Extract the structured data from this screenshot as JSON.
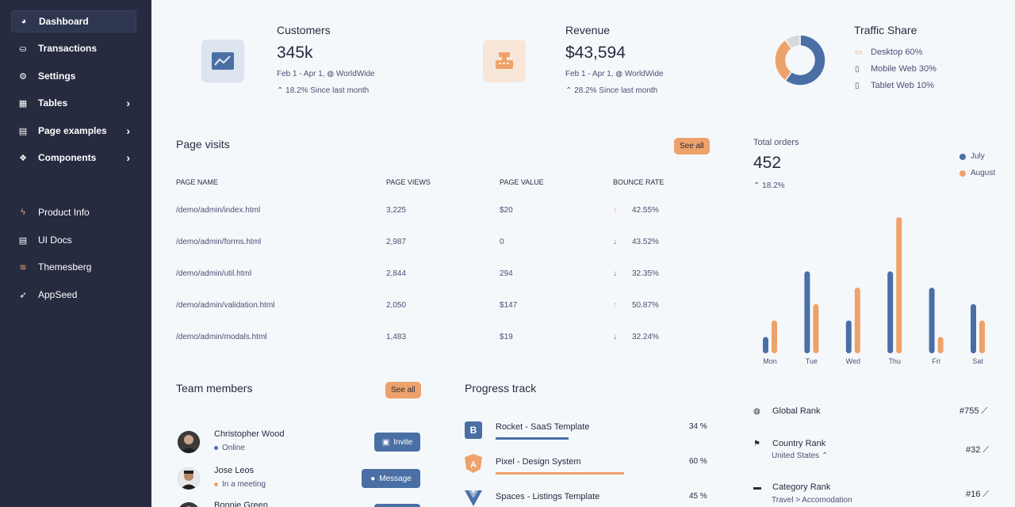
{
  "sidebar": {
    "items": [
      {
        "label": "Dashboard",
        "icon": "pie-chart-icon"
      },
      {
        "label": "Transactions",
        "icon": "hand-coin-icon"
      },
      {
        "label": "Settings",
        "icon": "gear-icon"
      },
      {
        "label": "Tables",
        "icon": "table-icon"
      },
      {
        "label": "Page examples",
        "icon": "file-icon"
      },
      {
        "label": "Components",
        "icon": "components-icon"
      },
      {
        "label": "Product Info",
        "icon": "bolt-icon"
      },
      {
        "label": "UI Docs",
        "icon": "document-icon"
      },
      {
        "label": "Themesberg",
        "icon": "themesberg-icon"
      },
      {
        "label": "AppSeed",
        "icon": "rocket-icon"
      }
    ]
  },
  "stats": {
    "customers": {
      "title": "Customers",
      "value": "345k",
      "range": "Feb 1 - Apr 1,",
      "region": "WorldWide",
      "delta": "18.2% Since last month"
    },
    "revenue": {
      "title": "Revenue",
      "value": "$43,594",
      "range": "Feb 1 - Apr 1,",
      "region": "WorldWide",
      "delta": "28.2% Since last month"
    }
  },
  "traffic": {
    "title": "Traffic Share",
    "items": [
      {
        "label": "Desktop 60%",
        "icon": "desktop-icon"
      },
      {
        "label": "Mobile Web 30%",
        "icon": "mobile-icon"
      },
      {
        "label": "Tablet Web 10%",
        "icon": "tablet-icon"
      }
    ],
    "shares": [
      60,
      30,
      10
    ]
  },
  "page_visits": {
    "title": "Page visits",
    "see_all": "See all",
    "headers": [
      "PAGE NAME",
      "PAGE VIEWS",
      "PAGE VALUE",
      "BOUNCE RATE"
    ],
    "rows": [
      {
        "name": "/demo/admin/index.html",
        "views": "3,225",
        "value": "$20",
        "bounce": "42.55%",
        "trend": "up"
      },
      {
        "name": "/demo/admin/forms.html",
        "views": "2,987",
        "value": "0",
        "bounce": "43.52%",
        "trend": "down"
      },
      {
        "name": "/demo/admin/util.html",
        "views": "2,844",
        "value": "294",
        "bounce": "32.35%",
        "trend": "down"
      },
      {
        "name": "/demo/admin/validation.html",
        "views": "2,050",
        "value": "$147",
        "bounce": "50.87%",
        "trend": "up"
      },
      {
        "name": "/demo/admin/modals.html",
        "views": "1,483",
        "value": "$19",
        "bounce": "32.24%",
        "trend": "down"
      }
    ]
  },
  "orders": {
    "label": "Total orders",
    "value": "452",
    "delta": "18.2%",
    "legend": [
      "July",
      "August"
    ]
  },
  "chart_data": {
    "type": "bar",
    "categories": [
      "Mon",
      "Tue",
      "Wed",
      "Thu",
      "Fri",
      "Sat"
    ],
    "series": [
      {
        "name": "July",
        "values": [
          1,
          5,
          2,
          5,
          4,
          3
        ],
        "color": "#4a6fa5"
      },
      {
        "name": "August",
        "values": [
          2,
          3,
          4,
          8.3,
          1,
          2
        ],
        "color": "#eea26b"
      }
    ],
    "ylim": [
      0,
      8.5
    ]
  },
  "team": {
    "title": "Team members",
    "see_all": "See all",
    "members": [
      {
        "name": "Christopher Wood",
        "status": "Online",
        "status_color": "#4a6fa5",
        "action": "Invite"
      },
      {
        "name": "Jose Leos",
        "status": "In a meeting",
        "status_color": "#eea26b",
        "action": "Message"
      },
      {
        "name": "Bonnie Green",
        "status": "",
        "status_color": "#4a6fa5",
        "action": ""
      }
    ]
  },
  "progress": {
    "title": "Progress track",
    "items": [
      {
        "name": "Rocket - SaaS Template",
        "pct_label": "34 %",
        "pct": 34,
        "color": "#4a6fa5",
        "icon": "bootstrap-icon"
      },
      {
        "name": "Pixel - Design System",
        "pct_label": "60 %",
        "pct": 60,
        "color": "#eea26b",
        "icon": "angular-icon"
      },
      {
        "name": "Spaces - Listings Template",
        "pct_label": "45 %",
        "pct": 45,
        "color": "#4a6fa5",
        "icon": "vue-icon"
      }
    ]
  },
  "ranks": [
    {
      "label": "Global Rank",
      "sub": "",
      "value": "#755",
      "icon": "globe-icon"
    },
    {
      "label": "Country Rank",
      "sub": "United States",
      "value": "#32",
      "icon": "flag-icon"
    },
    {
      "label": "Category Rank",
      "sub": "Travel > Accomodation",
      "value": "#16",
      "icon": "folder-icon"
    }
  ]
}
